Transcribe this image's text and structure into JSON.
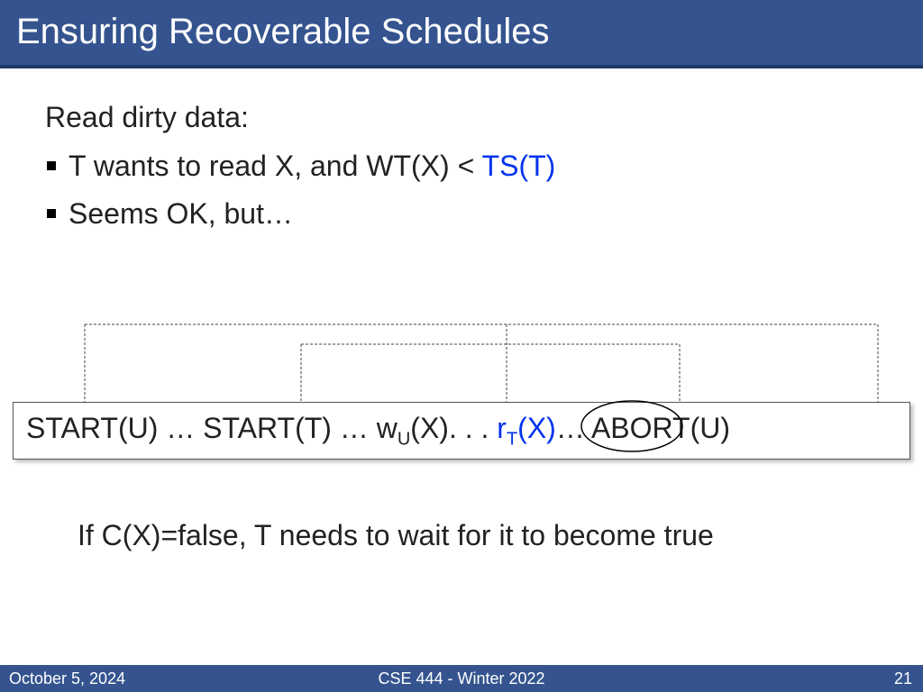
{
  "title": "Ensuring Recoverable Schedules",
  "lead": "Read dirty data:",
  "bullets": [
    {
      "prefix": "T wants to read X, and WT(X) < ",
      "blue": "TS(T)"
    },
    {
      "prefix": "Seems OK, but…",
      "blue": ""
    }
  ],
  "sequence": {
    "p1": "START(U) … START(T) … w",
    "subU": "U",
    "p2": "(X). . . ",
    "rt_r": "r",
    "rt_sub": "T",
    "rt_tail": "(X)",
    "p3": "… ABORT(U)"
  },
  "note": "If C(X)=false, T needs to wait for it to become true",
  "footer": {
    "date": "October 5, 2024",
    "course": "CSE 444 - Winter 2022",
    "page": "21"
  }
}
